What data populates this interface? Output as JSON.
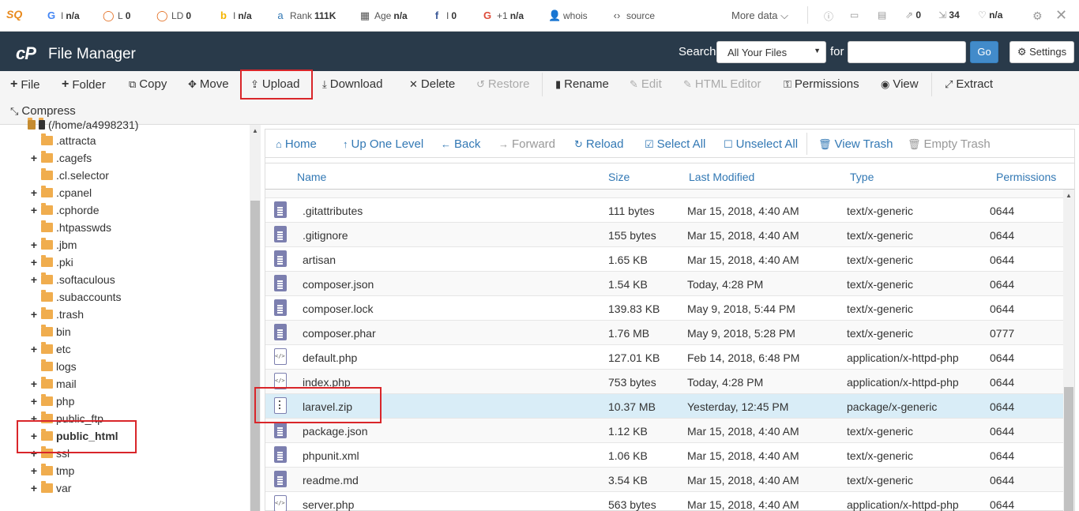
{
  "seo": {
    "g": "G",
    "g_val": "n/a",
    "l": "L",
    "l_val": "0",
    "ld": "LD",
    "ld_val": "0",
    "b": "b",
    "b_val": "n/a",
    "rank": "Rank",
    "rank_val": "111K",
    "age": "Age",
    "age_val": "n/a",
    "f_val": "0",
    "plus": "+1",
    "plus_val": "n/a",
    "whois": "whois",
    "source": "source",
    "more": "More data",
    "r2": "0",
    "r3": "34",
    "r4": "n/a"
  },
  "header": {
    "logo": "cP",
    "title": "File Manager",
    "search_label": "Search",
    "search_scope": "All Your Files",
    "for_label": "for",
    "go": "Go",
    "settings": "Settings"
  },
  "toolbar": {
    "file": "File",
    "folder": "Folder",
    "copy": "Copy",
    "move": "Move",
    "upload": "Upload",
    "download": "Download",
    "delete": "Delete",
    "restore": "Restore",
    "rename": "Rename",
    "edit": "Edit",
    "html_editor": "HTML Editor",
    "permissions": "Permissions",
    "view": "View",
    "extract": "Extract",
    "compress": "Compress"
  },
  "tree": {
    "root": "(/home/a4998231)",
    "items": [
      ".attracta",
      ".cagefs",
      ".cl.selector",
      ".cpanel",
      ".cphorde",
      ".htpasswds",
      ".jbm",
      ".pki",
      ".softaculous",
      ".subaccounts",
      ".trash",
      "bin",
      "etc",
      "logs",
      "mail",
      "php",
      "public_ftp",
      "public_html",
      "ssl",
      "tmp",
      "var"
    ]
  },
  "nav": {
    "home": "Home",
    "up": "Up One Level",
    "back": "Back",
    "forward": "Forward",
    "reload": "Reload",
    "select_all": "Select All",
    "unselect_all": "Unselect All",
    "view_trash": "View Trash",
    "empty_trash": "Empty Trash"
  },
  "columns": {
    "name": "Name",
    "size": "Size",
    "modified": "Last Modified",
    "type": "Type",
    "perms": "Permissions"
  },
  "files": [
    {
      "name": ".gitattributes",
      "size": "111 bytes",
      "modified": "Mar 15, 2018, 4:40 AM",
      "type": "text/x-generic",
      "perms": "0644",
      "icon": "doc-icon"
    },
    {
      "name": ".gitignore",
      "size": "155 bytes",
      "modified": "Mar 15, 2018, 4:40 AM",
      "type": "text/x-generic",
      "perms": "0644",
      "icon": "doc-icon"
    },
    {
      "name": "artisan",
      "size": "1.65 KB",
      "modified": "Mar 15, 2018, 4:40 AM",
      "type": "text/x-generic",
      "perms": "0644",
      "icon": "doc-icon"
    },
    {
      "name": "composer.json",
      "size": "1.54 KB",
      "modified": "Today, 4:28 PM",
      "type": "text/x-generic",
      "perms": "0644",
      "icon": "doc-icon"
    },
    {
      "name": "composer.lock",
      "size": "139.83 KB",
      "modified": "May 9, 2018, 5:44 PM",
      "type": "text/x-generic",
      "perms": "0644",
      "icon": "doc-icon"
    },
    {
      "name": "composer.phar",
      "size": "1.76 MB",
      "modified": "May 9, 2018, 5:28 PM",
      "type": "text/x-generic",
      "perms": "0777",
      "icon": "doc-icon"
    },
    {
      "name": "default.php",
      "size": "127.01 KB",
      "modified": "Feb 14, 2018, 6:48 PM",
      "type": "application/x-httpd-php",
      "perms": "0644",
      "icon": "code-icon"
    },
    {
      "name": "index.php",
      "size": "753 bytes",
      "modified": "Today, 4:28 PM",
      "type": "application/x-httpd-php",
      "perms": "0644",
      "icon": "code-icon"
    },
    {
      "name": "laravel.zip",
      "size": "10.37 MB",
      "modified": "Yesterday, 12:45 PM",
      "type": "package/x-generic",
      "perms": "0644",
      "icon": "zip-icon"
    },
    {
      "name": "package.json",
      "size": "1.12 KB",
      "modified": "Mar 15, 2018, 4:40 AM",
      "type": "text/x-generic",
      "perms": "0644",
      "icon": "doc-icon"
    },
    {
      "name": "phpunit.xml",
      "size": "1.06 KB",
      "modified": "Mar 15, 2018, 4:40 AM",
      "type": "text/x-generic",
      "perms": "0644",
      "icon": "doc-icon"
    },
    {
      "name": "readme.md",
      "size": "3.54 KB",
      "modified": "Mar 15, 2018, 4:40 AM",
      "type": "text/x-generic",
      "perms": "0644",
      "icon": "doc-icon"
    },
    {
      "name": "server.php",
      "size": "563 bytes",
      "modified": "Mar 15, 2018, 4:40 AM",
      "type": "application/x-httpd-php",
      "perms": "0644",
      "icon": "code-icon"
    }
  ],
  "selected_file": "laravel.zip",
  "colors": {
    "header_bg": "#293a4a",
    "link": "#3278b4",
    "highlight": "#d9262a",
    "selected_row": "#d9edf7",
    "folder": "#f0ad4e"
  }
}
